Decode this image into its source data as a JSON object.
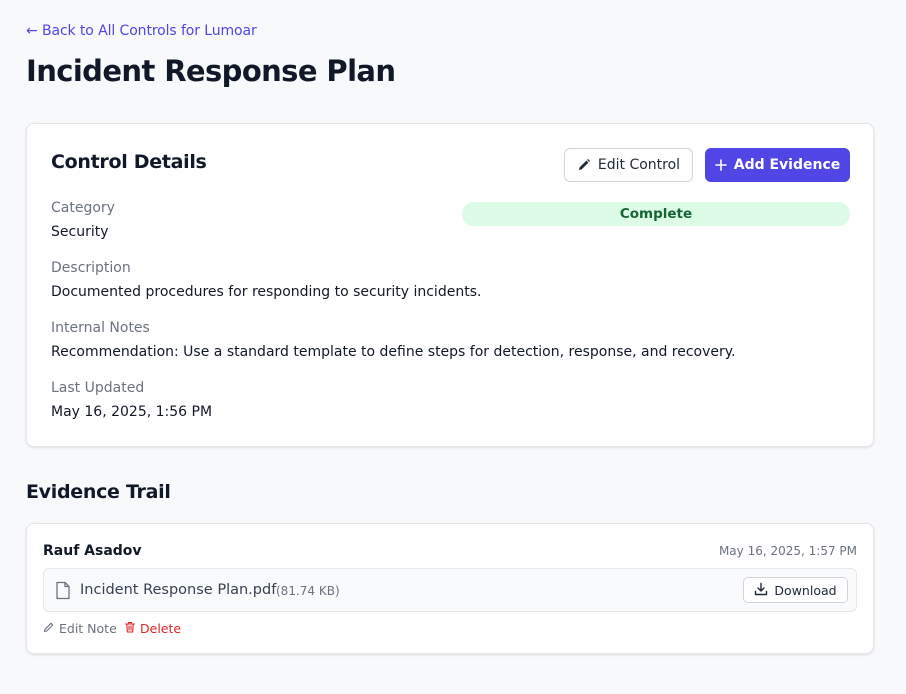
{
  "nav": {
    "back_label": "← Back to All Controls for Lumoar"
  },
  "page": {
    "title": "Incident Response Plan"
  },
  "details": {
    "heading": "Control Details",
    "edit_label": "Edit Control",
    "add_label": "Add Evidence",
    "status": "Complete",
    "fields": [
      {
        "label": "Category",
        "value": "Security"
      },
      {
        "label": "Description",
        "value": "Documented procedures for responding to security incidents."
      },
      {
        "label": "Internal Notes",
        "value": "Recommendation: Use a standard template to define steps for detection, response, and recovery."
      },
      {
        "label": "Last Updated",
        "value": "May 16, 2025, 1:56 PM"
      }
    ]
  },
  "evidence": {
    "heading": "Evidence Trail",
    "items": [
      {
        "author": "Rauf Asadov",
        "timestamp": "May 16, 2025, 1:57 PM",
        "file_name": "Incident Response Plan.pdf",
        "file_size": "(81.74 KB)",
        "download_label": "Download",
        "edit_note_label": "Edit Note",
        "delete_label": "Delete"
      }
    ]
  },
  "colors": {
    "accent": "#4f46e5",
    "status_bg": "#dcfce7",
    "status_text": "#166534",
    "danger": "#dc2626"
  },
  "icons": [
    "pencil-icon",
    "plus-icon",
    "file-icon",
    "download-icon",
    "trash-icon"
  ]
}
